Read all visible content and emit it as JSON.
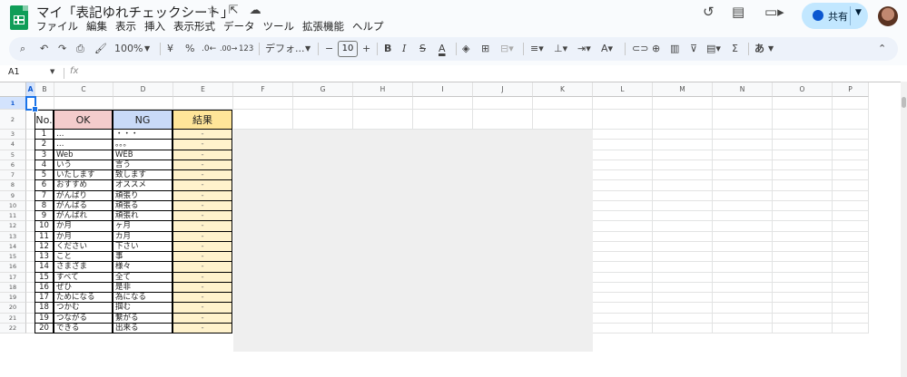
{
  "doc": {
    "title": "マイ「表記ゆれチェックシート」"
  },
  "menu": [
    "ファイル",
    "編集",
    "表示",
    "挿入",
    "表示形式",
    "データ",
    "ツール",
    "拡張機能",
    "ヘルプ"
  ],
  "header": {
    "share_label": "共有"
  },
  "toolbar": {
    "zoom": "100%",
    "currency": "¥",
    "percent": "%",
    "dec_decrease": ".0←",
    "dec_increase": ".00→",
    "number_format": "123",
    "font": "デフォ...",
    "font_size": "10",
    "input_tools": "あ"
  },
  "formula_bar": {
    "cell_ref": "A1",
    "fx": "fx",
    "value": ""
  },
  "columns": [
    "A",
    "B",
    "C",
    "D",
    "E",
    "F",
    "G",
    "H",
    "I",
    "J",
    "K",
    "L",
    "M",
    "N",
    "O",
    "P"
  ],
  "rows": [
    "1",
    "2",
    "3",
    "4",
    "5",
    "6",
    "7",
    "8",
    "9",
    "10",
    "11",
    "12",
    "13",
    "14",
    "15",
    "16",
    "17",
    "18",
    "19",
    "20",
    "21",
    "22"
  ],
  "table": {
    "headers": {
      "no": "No.",
      "ok": "OK",
      "ng": "NG",
      "result": "結果"
    },
    "rows": [
      {
        "no": "1",
        "ok": "…",
        "ng": "・・・",
        "result": "-"
      },
      {
        "no": "2",
        "ok": "…",
        "ng": "。。。",
        "result": "-"
      },
      {
        "no": "3",
        "ok": "Web",
        "ng": "WEB",
        "result": "-"
      },
      {
        "no": "4",
        "ok": "いう",
        "ng": "言う",
        "result": "-"
      },
      {
        "no": "5",
        "ok": "いたします",
        "ng": "致します",
        "result": "-"
      },
      {
        "no": "6",
        "ok": "おすすめ",
        "ng": "オススメ",
        "result": "-"
      },
      {
        "no": "7",
        "ok": "がんばり",
        "ng": "頑張り",
        "result": "-"
      },
      {
        "no": "8",
        "ok": "がんばる",
        "ng": "頑張る",
        "result": "-"
      },
      {
        "no": "9",
        "ok": "がんばれ",
        "ng": "頑張れ",
        "result": "-"
      },
      {
        "no": "10",
        "ok": "か月",
        "ng": "ヶ月",
        "result": "-"
      },
      {
        "no": "11",
        "ok": "か月",
        "ng": "カ月",
        "result": "-"
      },
      {
        "no": "12",
        "ok": "ください",
        "ng": "下さい",
        "result": "-"
      },
      {
        "no": "13",
        "ok": "こと",
        "ng": "事",
        "result": "-"
      },
      {
        "no": "14",
        "ok": "さまざま",
        "ng": "様々",
        "result": "-"
      },
      {
        "no": "15",
        "ok": "すべて",
        "ng": "全て",
        "result": "-"
      },
      {
        "no": "16",
        "ok": "ぜひ",
        "ng": "是非",
        "result": "-"
      },
      {
        "no": "17",
        "ok": "ためになる",
        "ng": "為になる",
        "result": "-"
      },
      {
        "no": "18",
        "ok": "つかむ",
        "ng": "掴む",
        "result": "-"
      },
      {
        "no": "19",
        "ok": "つながる",
        "ng": "繋がる",
        "result": "-"
      },
      {
        "no": "20",
        "ok": "できる",
        "ng": "出来る",
        "result": "-"
      }
    ]
  },
  "colors": {
    "ok_header": "#f4cccc",
    "ng_header": "#c9daf8",
    "result_header": "#ffe599",
    "result_cell": "#fff2cc",
    "selection": "#1a73e8"
  }
}
